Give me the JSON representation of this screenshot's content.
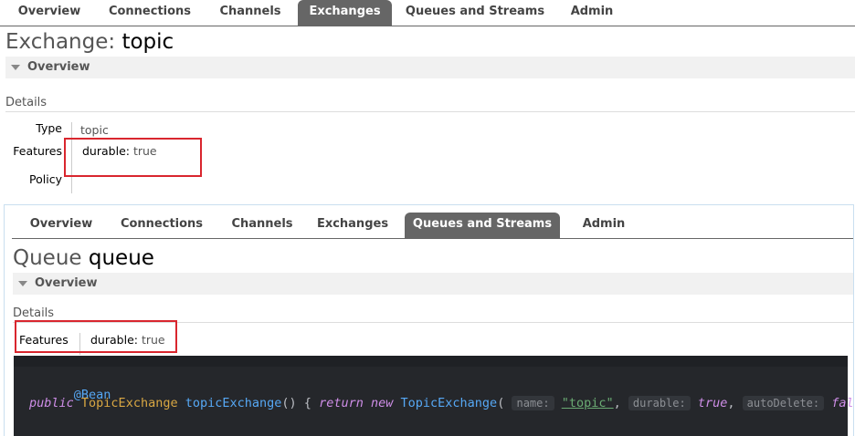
{
  "exchange_panel": {
    "tabs": [
      "Overview",
      "Connections",
      "Channels",
      "Exchanges",
      "Queues and Streams",
      "Admin"
    ],
    "active_tab": "Exchanges",
    "title_prefix": "Exchange:",
    "title_name": "topic",
    "section": "Overview",
    "details_label": "Details",
    "rows": {
      "type_key": "Type",
      "type_val": "topic",
      "features_key": "Features",
      "features_sub_key": "durable:",
      "features_sub_val": "true",
      "policy_key": "Policy"
    }
  },
  "queue_panel": {
    "tabs": [
      "Overview",
      "Connections",
      "Channels",
      "Exchanges",
      "Queues and Streams",
      "Admin"
    ],
    "active_tab": "Queues and Streams",
    "title_prefix": "Queue",
    "title_name": "queue",
    "section": "Overview",
    "details_label": "Details",
    "features_key": "Features",
    "features_sub_key": "durable:",
    "features_sub_val": "true"
  },
  "code": {
    "annotation": "@Bean",
    "kw_public": "public",
    "return_type": "TopicExchange",
    "method": "topicExchange",
    "open": "() {",
    "kw_return": "return",
    "kw_new": "new",
    "ctor": "TopicExchange",
    "paren": "(",
    "hint_name": "name:",
    "str_value": "\"topic\"",
    "comma": ",",
    "hint_durable": "durable:",
    "durable_val": "true",
    "hint_autodelete": "autoDelete:",
    "autodelete_val": "false",
    "close": ");",
    "brace": "}"
  },
  "colors": {
    "active_tab": "#666666",
    "highlight_box": "#d9262e",
    "code_bg": "#25272b"
  }
}
